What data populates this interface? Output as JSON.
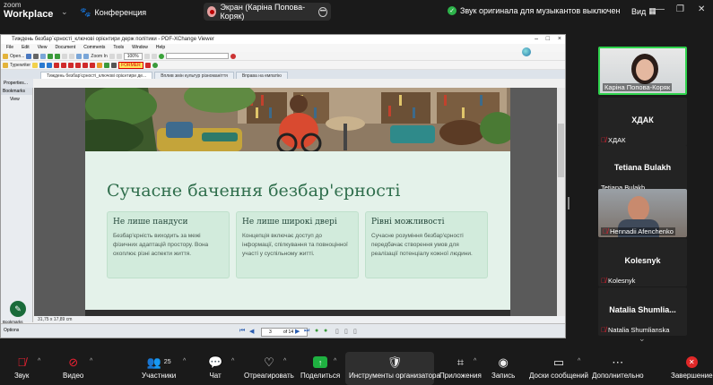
{
  "top_bar": {
    "logo_top": "zoom",
    "logo_bottom": "Workplace",
    "conference_label": "Конференция",
    "share_pill_label": "Экран (Каріна Попова-Коряк)",
    "original_sound_label": "Звук оригинала для музыкантов выключен",
    "view_label": "Вид"
  },
  "pdf_viewer": {
    "window_title": "Тиждень безбар`єрності_ключові орієнтири держ політики - PDF-XChange Viewer",
    "menu": [
      "File",
      "Edit",
      "View",
      "Document",
      "Comments",
      "Tools",
      "Window",
      "Help"
    ],
    "toolbar_labels": {
      "open": "Open...",
      "zoom_in": "Zoom In",
      "zoom_pct": "100%",
      "typewriter": "Typewriter",
      "highlight": "FORMER"
    },
    "tabs": [
      "Тиждень безбар'єрності_ключові орієнтири де...",
      "Вплив змін культур різноманіття",
      "Вправа на емпатію"
    ],
    "sidebar_header": "Bookmarks",
    "sidebar_view": "View",
    "sidebar_props": "Properties...",
    "status_text": "31,75 x 17,89 cm",
    "page_current": "3",
    "page_total": "of 14",
    "options_label": "Options",
    "bookmarks_tab": "Bookmarks"
  },
  "slide": {
    "title": "Сучасне бачення безбар'єрності",
    "cards": [
      {
        "title": "Не лише пандуси",
        "body": "Безбар'єрність виходить за межі фізичних адаптацій простору. Вона охоплює різні аспекти життя."
      },
      {
        "title": "Не лише широкі двері",
        "body": "Концепція включає доступ до інформації, спілкування та повноцінної участі у суспільному житті."
      },
      {
        "title": "Рівні можливості",
        "body": "Сучасне розуміння безбар'єрності передбачає створення умов для реалізації потенціалу кожної людини."
      }
    ]
  },
  "participants": [
    {
      "name": "Каріна Попова-Коряк",
      "video": true,
      "active": true
    },
    {
      "name": "ХДАК",
      "big": "ХДАК",
      "muted": true
    },
    {
      "name": "Tetiana Bulakh",
      "big": "Tetiana Bulakh",
      "muted": false
    },
    {
      "name": "Hennadii Afenchenko",
      "video": true,
      "muted": true
    },
    {
      "name": "Kolesnyk",
      "big": "Kolesnyk",
      "muted": true
    },
    {
      "name": "Natalia Shumlianska",
      "big": "Natalia  Shumlia...",
      "muted": true
    }
  ],
  "toolbar": {
    "audio": "Звук",
    "video": "Видео",
    "participants": "Участники",
    "participants_count": "25",
    "chat": "Чат",
    "react": "Отреагировать",
    "share": "Поделиться",
    "host_tools": "Инструменты организатора",
    "apps": "Приложения",
    "record": "Запись",
    "whiteboards": "Доски сообщений",
    "more": "Дополнительно",
    "end": "Завершение"
  },
  "colors": {
    "slide_bg": "#e4f2ea",
    "slide_title": "#2f6e4c",
    "card_bg": "#d2ebdc",
    "active_speaker": "#2fd34d",
    "share_green": "#1fb141",
    "end_red": "#e02828"
  }
}
